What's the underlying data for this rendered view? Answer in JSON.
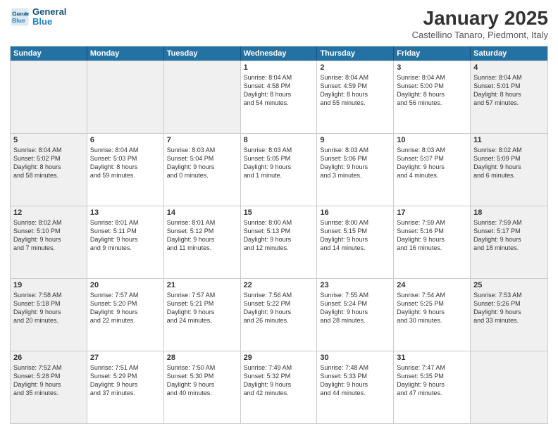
{
  "header": {
    "logo_line1": "General",
    "logo_line2": "Blue",
    "title": "January 2025",
    "subtitle": "Castellino Tanaro, Piedmont, Italy"
  },
  "days_of_week": [
    "Sunday",
    "Monday",
    "Tuesday",
    "Wednesday",
    "Thursday",
    "Friday",
    "Saturday"
  ],
  "weeks": [
    [
      {
        "day": "",
        "text": "",
        "shaded": true
      },
      {
        "day": "",
        "text": "",
        "shaded": true
      },
      {
        "day": "",
        "text": "",
        "shaded": true
      },
      {
        "day": "1",
        "text": "Sunrise: 8:04 AM\nSunset: 4:58 PM\nDaylight: 8 hours\nand 54 minutes.",
        "shaded": false
      },
      {
        "day": "2",
        "text": "Sunrise: 8:04 AM\nSunset: 4:59 PM\nDaylight: 8 hours\nand 55 minutes.",
        "shaded": false
      },
      {
        "day": "3",
        "text": "Sunrise: 8:04 AM\nSunset: 5:00 PM\nDaylight: 8 hours\nand 56 minutes.",
        "shaded": false
      },
      {
        "day": "4",
        "text": "Sunrise: 8:04 AM\nSunset: 5:01 PM\nDaylight: 8 hours\nand 57 minutes.",
        "shaded": true
      }
    ],
    [
      {
        "day": "5",
        "text": "Sunrise: 8:04 AM\nSunset: 5:02 PM\nDaylight: 8 hours\nand 58 minutes.",
        "shaded": true
      },
      {
        "day": "6",
        "text": "Sunrise: 8:04 AM\nSunset: 5:03 PM\nDaylight: 8 hours\nand 59 minutes.",
        "shaded": false
      },
      {
        "day": "7",
        "text": "Sunrise: 8:03 AM\nSunset: 5:04 PM\nDaylight: 9 hours\nand 0 minutes.",
        "shaded": false
      },
      {
        "day": "8",
        "text": "Sunrise: 8:03 AM\nSunset: 5:05 PM\nDaylight: 9 hours\nand 1 minute.",
        "shaded": false
      },
      {
        "day": "9",
        "text": "Sunrise: 8:03 AM\nSunset: 5:06 PM\nDaylight: 9 hours\nand 3 minutes.",
        "shaded": false
      },
      {
        "day": "10",
        "text": "Sunrise: 8:03 AM\nSunset: 5:07 PM\nDaylight: 9 hours\nand 4 minutes.",
        "shaded": false
      },
      {
        "day": "11",
        "text": "Sunrise: 8:02 AM\nSunset: 5:09 PM\nDaylight: 9 hours\nand 6 minutes.",
        "shaded": true
      }
    ],
    [
      {
        "day": "12",
        "text": "Sunrise: 8:02 AM\nSunset: 5:10 PM\nDaylight: 9 hours\nand 7 minutes.",
        "shaded": true
      },
      {
        "day": "13",
        "text": "Sunrise: 8:01 AM\nSunset: 5:11 PM\nDaylight: 9 hours\nand 9 minutes.",
        "shaded": false
      },
      {
        "day": "14",
        "text": "Sunrise: 8:01 AM\nSunset: 5:12 PM\nDaylight: 9 hours\nand 11 minutes.",
        "shaded": false
      },
      {
        "day": "15",
        "text": "Sunrise: 8:00 AM\nSunset: 5:13 PM\nDaylight: 9 hours\nand 12 minutes.",
        "shaded": false
      },
      {
        "day": "16",
        "text": "Sunrise: 8:00 AM\nSunset: 5:15 PM\nDaylight: 9 hours\nand 14 minutes.",
        "shaded": false
      },
      {
        "day": "17",
        "text": "Sunrise: 7:59 AM\nSunset: 5:16 PM\nDaylight: 9 hours\nand 16 minutes.",
        "shaded": false
      },
      {
        "day": "18",
        "text": "Sunrise: 7:59 AM\nSunset: 5:17 PM\nDaylight: 9 hours\nand 18 minutes.",
        "shaded": true
      }
    ],
    [
      {
        "day": "19",
        "text": "Sunrise: 7:58 AM\nSunset: 5:18 PM\nDaylight: 9 hours\nand 20 minutes.",
        "shaded": true
      },
      {
        "day": "20",
        "text": "Sunrise: 7:57 AM\nSunset: 5:20 PM\nDaylight: 9 hours\nand 22 minutes.",
        "shaded": false
      },
      {
        "day": "21",
        "text": "Sunrise: 7:57 AM\nSunset: 5:21 PM\nDaylight: 9 hours\nand 24 minutes.",
        "shaded": false
      },
      {
        "day": "22",
        "text": "Sunrise: 7:56 AM\nSunset: 5:22 PM\nDaylight: 9 hours\nand 26 minutes.",
        "shaded": false
      },
      {
        "day": "23",
        "text": "Sunrise: 7:55 AM\nSunset: 5:24 PM\nDaylight: 9 hours\nand 28 minutes.",
        "shaded": false
      },
      {
        "day": "24",
        "text": "Sunrise: 7:54 AM\nSunset: 5:25 PM\nDaylight: 9 hours\nand 30 minutes.",
        "shaded": false
      },
      {
        "day": "25",
        "text": "Sunrise: 7:53 AM\nSunset: 5:26 PM\nDaylight: 9 hours\nand 33 minutes.",
        "shaded": true
      }
    ],
    [
      {
        "day": "26",
        "text": "Sunrise: 7:52 AM\nSunset: 5:28 PM\nDaylight: 9 hours\nand 35 minutes.",
        "shaded": true
      },
      {
        "day": "27",
        "text": "Sunrise: 7:51 AM\nSunset: 5:29 PM\nDaylight: 9 hours\nand 37 minutes.",
        "shaded": false
      },
      {
        "day": "28",
        "text": "Sunrise: 7:50 AM\nSunset: 5:30 PM\nDaylight: 9 hours\nand 40 minutes.",
        "shaded": false
      },
      {
        "day": "29",
        "text": "Sunrise: 7:49 AM\nSunset: 5:32 PM\nDaylight: 9 hours\nand 42 minutes.",
        "shaded": false
      },
      {
        "day": "30",
        "text": "Sunrise: 7:48 AM\nSunset: 5:33 PM\nDaylight: 9 hours\nand 44 minutes.",
        "shaded": false
      },
      {
        "day": "31",
        "text": "Sunrise: 7:47 AM\nSunset: 5:35 PM\nDaylight: 9 hours\nand 47 minutes.",
        "shaded": false
      },
      {
        "day": "",
        "text": "",
        "shaded": true
      }
    ]
  ]
}
